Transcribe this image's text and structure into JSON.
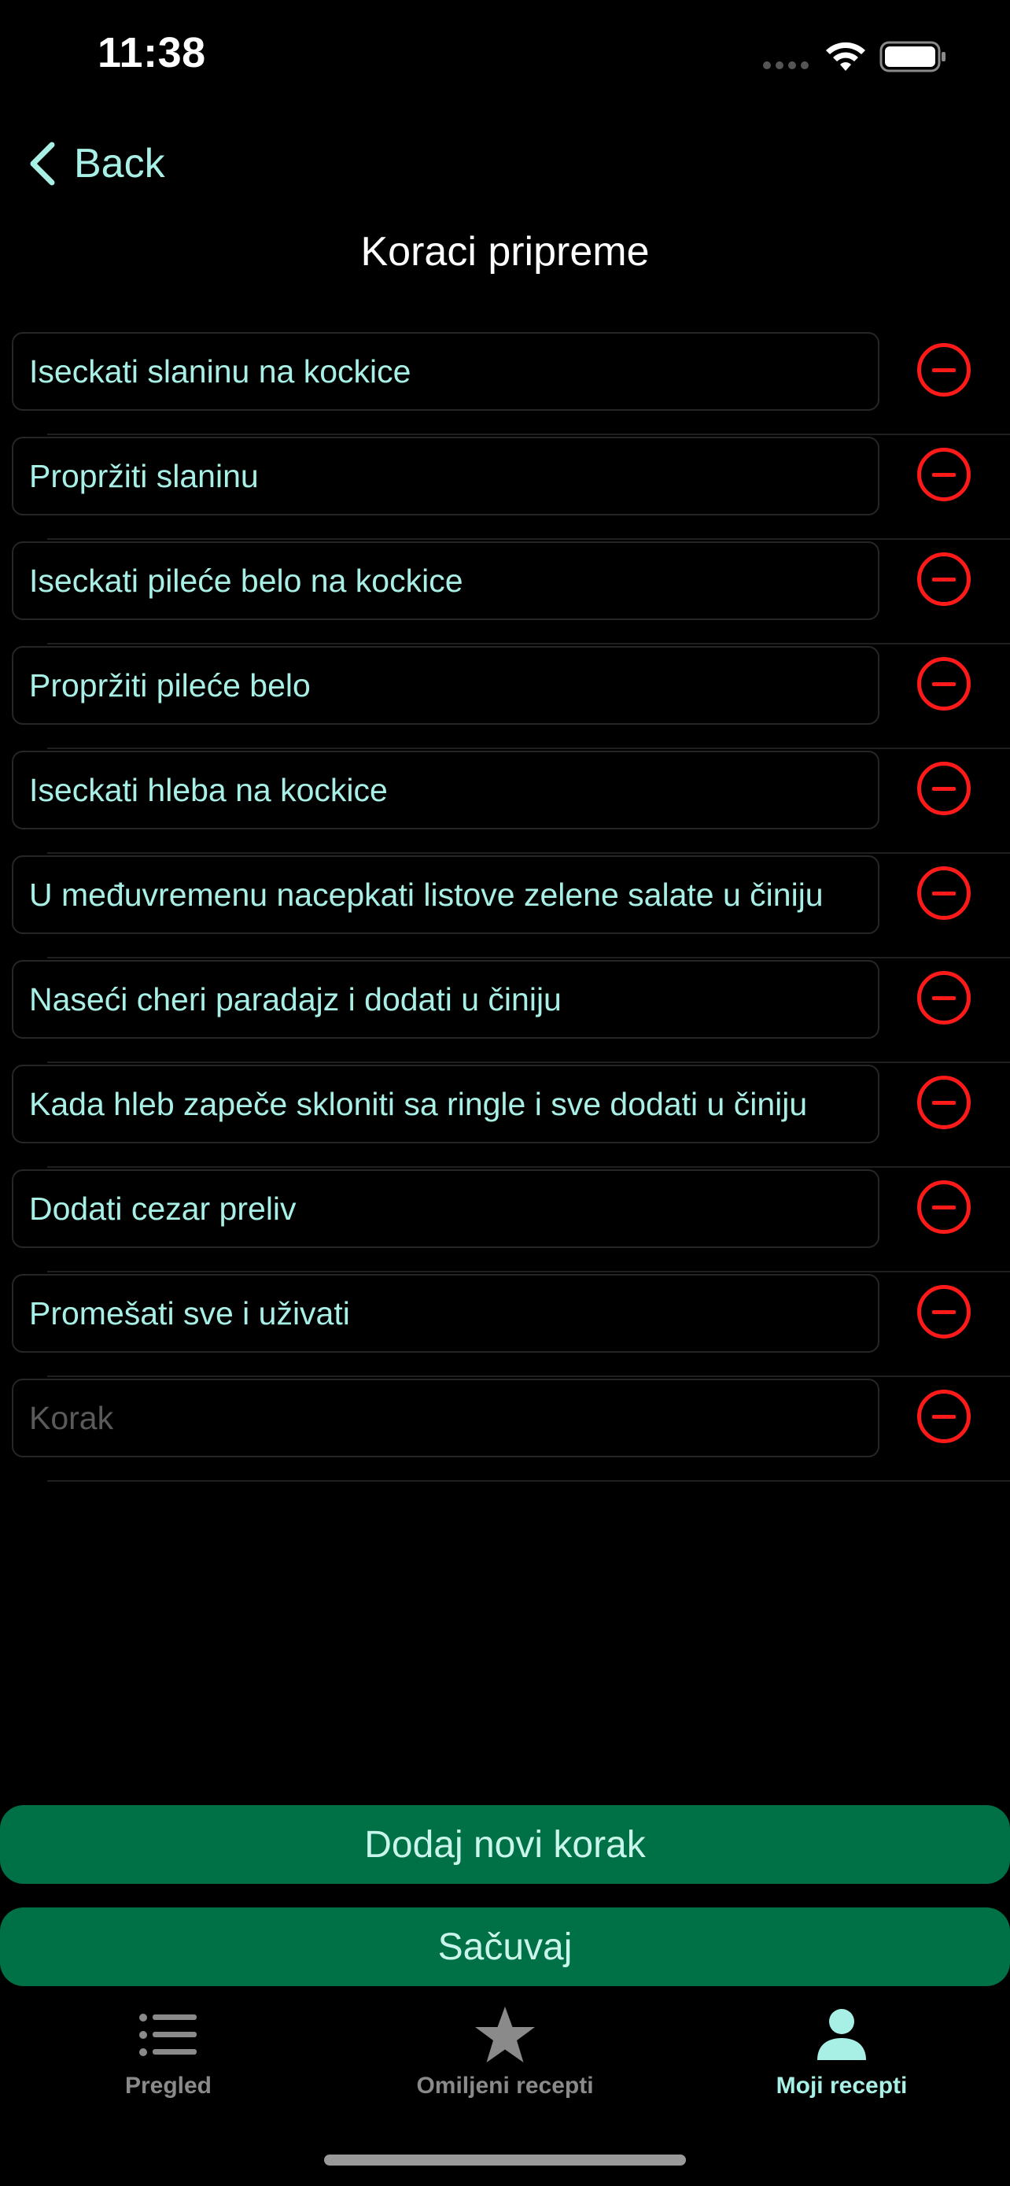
{
  "status_bar": {
    "time": "11:38"
  },
  "nav": {
    "back_label": "Back",
    "title": "Koraci pripreme"
  },
  "steps": [
    {
      "text": "Iseckati slaninu na kockice"
    },
    {
      "text": "Propržiti slaninu"
    },
    {
      "text": "Iseckati pileće belo na kockice"
    },
    {
      "text": "Propržiti pileće belo"
    },
    {
      "text": "Iseckati hleba na kockice"
    },
    {
      "text": "U međuvremenu nacepkati listove zelene salate u činiju"
    },
    {
      "text": "Naseći cheri paradajz i dodati u činiju"
    },
    {
      "text": "Kada hleb zapeče skloniti sa ringle i sve dodati u činiju"
    },
    {
      "text": "Dodati cezar preliv"
    },
    {
      "text": "Promešati sve i uživati"
    }
  ],
  "new_step": {
    "value": "",
    "placeholder": "Korak"
  },
  "buttons": {
    "add_step": "Dodaj novi korak",
    "save": "Sačuvaj"
  },
  "tabs": [
    {
      "label": "Pregled",
      "icon": "list-icon",
      "active": false
    },
    {
      "label": "Omiljeni recepti",
      "icon": "star-icon",
      "active": false
    },
    {
      "label": "Moji recepti",
      "icon": "person-icon",
      "active": true
    }
  ],
  "colors": {
    "accent": "#a8f0e6",
    "button_green": "#007046",
    "remove_red": "#ff1a1a",
    "background": "#000000"
  }
}
